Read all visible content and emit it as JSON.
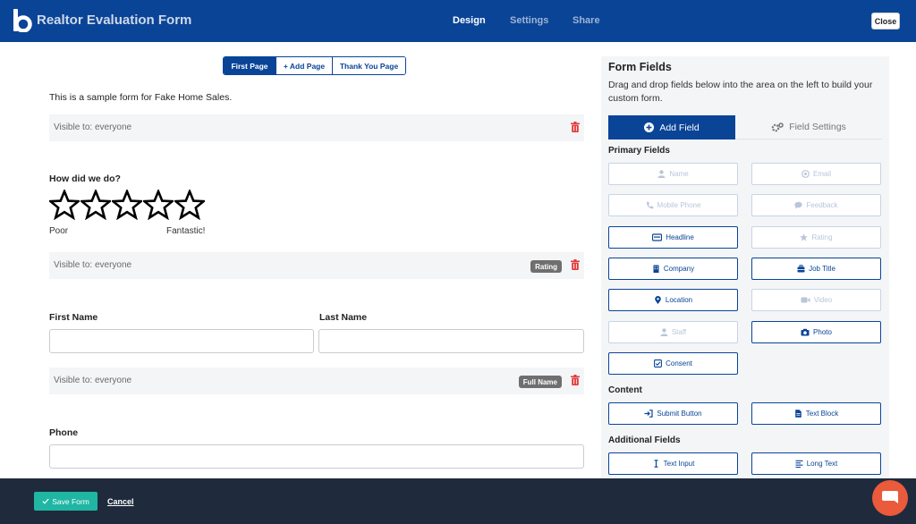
{
  "header": {
    "title": "Realtor Evaluation Form",
    "nav": [
      "Design",
      "Settings",
      "Share"
    ],
    "close_label": "Close"
  },
  "page_tabs": [
    "First Page",
    "+ Add Page",
    "Thank You Page"
  ],
  "form": {
    "intro": "This is a sample form for Fake Home Sales.",
    "visible_to": "Visible to:  everyone",
    "rating_question": "How did we do?",
    "rating_low": "Poor",
    "rating_high": "Fantastic!",
    "rating_badge": "Rating",
    "first_name": "First Name",
    "last_name": "Last Name",
    "full_name_badge": "Full Name",
    "phone": "Phone"
  },
  "panel": {
    "title": "Form Fields",
    "description": "Drag and drop fields below into the area on the left to build your custom form.",
    "tab_add": "Add Field",
    "tab_settings": "Field Settings",
    "primary_title": "Primary Fields",
    "primary": {
      "name": "Name",
      "email": "Email",
      "mobile": "Mobile Phone",
      "feedback": "Feedback",
      "headline": "Headline",
      "rating": "Rating",
      "company": "Company",
      "job_title": "Job Title",
      "location": "Location",
      "video": "Video",
      "staff": "Staff",
      "photo": "Photo",
      "consent": "Consent"
    },
    "content_title": "Content",
    "content": {
      "submit": "Submit Button",
      "text_block": "Text Block"
    },
    "additional_title": "Additional Fields",
    "additional": {
      "text_input": "Text Input",
      "long_text": "Long Text"
    }
  },
  "footer": {
    "save": "Save Form",
    "cancel": "Cancel"
  },
  "colors": {
    "brand": "#0a4497",
    "save": "#1fb6a3",
    "danger": "#e03b3b",
    "chat": "#ea5a3b"
  }
}
